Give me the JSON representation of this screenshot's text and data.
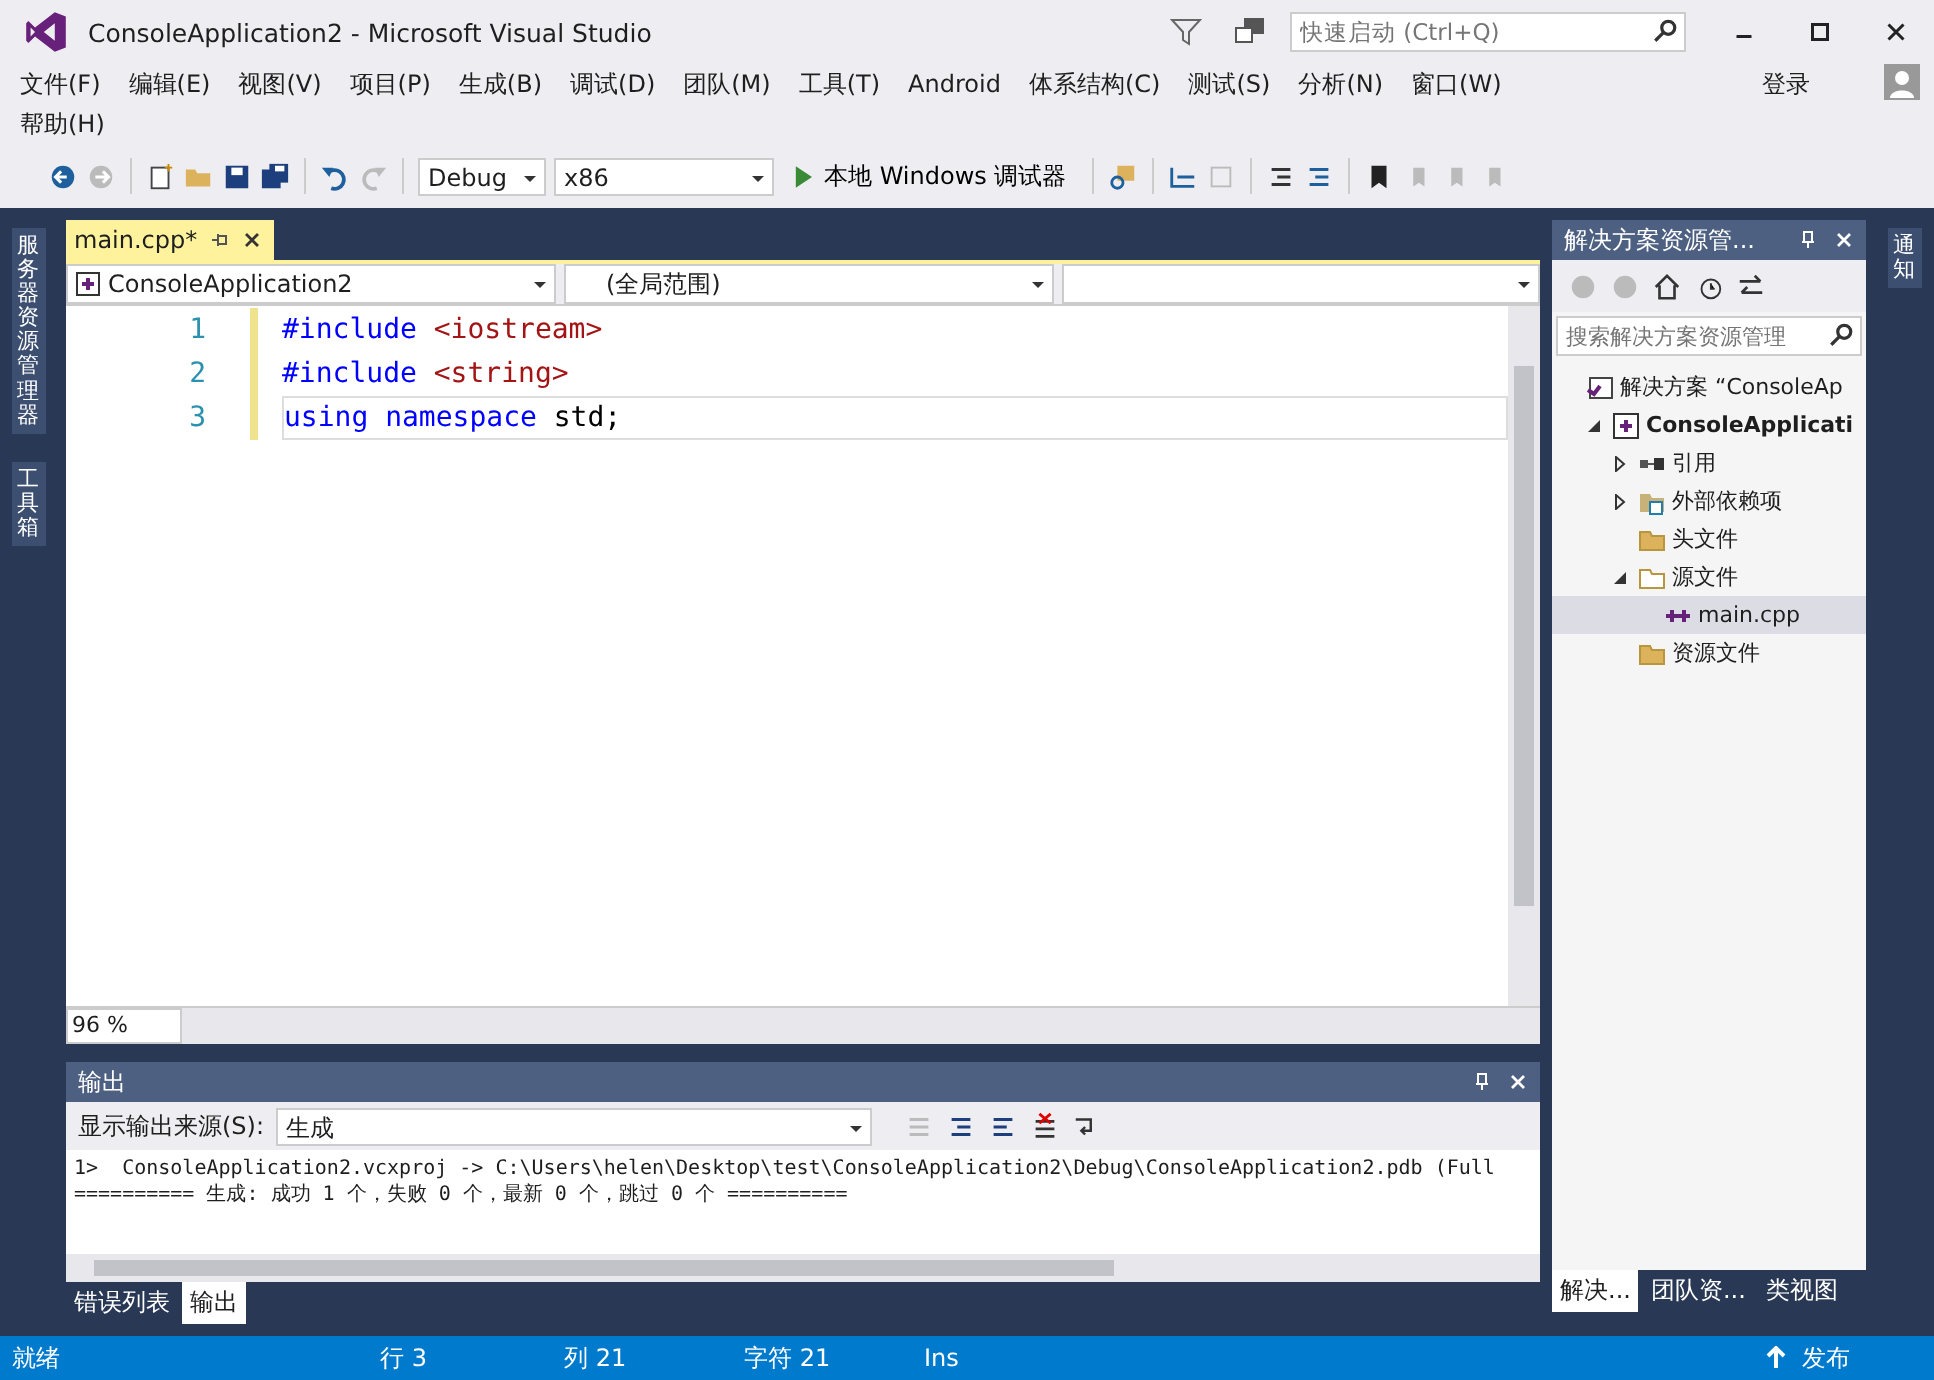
{
  "window": {
    "title": "ConsoleApplication2 - Microsoft Visual Studio",
    "quick_launch": {
      "placeholder": "快速启动 (Ctrl+Q)"
    }
  },
  "menu": [
    "文件(F)",
    "编辑(E)",
    "视图(V)",
    "项目(P)",
    "生成(B)",
    "调试(D)",
    "团队(M)",
    "工具(T)",
    "Android",
    "体系结构(C)",
    "测试(S)",
    "分析(N)",
    "窗口(W)",
    "帮助(H)"
  ],
  "sign_in": "登录",
  "toolbar": {
    "configuration": "Debug",
    "platform": "x86",
    "run": "本地 Windows 调试器"
  },
  "left_tabs": [
    "服务器资源管理器",
    "工具箱"
  ],
  "right_tabs": [
    "通知"
  ],
  "editor": {
    "tab": {
      "title": "main.cpp*"
    },
    "nav": {
      "project": "ConsoleApplication2",
      "scope": "(全局范围)"
    },
    "zoom": "96 %",
    "lines": [
      {
        "number": "1",
        "tokens": [
          {
            "text": "#include",
            "kind": "keyword"
          },
          {
            "text": " <iostream>",
            "kind": "string"
          }
        ]
      },
      {
        "number": "2",
        "tokens": [
          {
            "text": "#include",
            "kind": "keyword"
          },
          {
            "text": " <string>",
            "kind": "string"
          }
        ]
      },
      {
        "number": "3",
        "tokens": [
          {
            "text": "using namespace",
            "kind": "keyword"
          },
          {
            "text": " std;",
            "kind": "plain"
          }
        ]
      }
    ]
  },
  "solution_explorer": {
    "title": "解决方案资源管...",
    "search": {
      "placeholder": "搜索解决方案资源管理"
    },
    "tree": [
      {
        "label": "解决方案 “ConsoleAp",
        "kind": "solution",
        "selected": false,
        "children": [
          {
            "label": "ConsoleApplicati",
            "kind": "project",
            "expanded": true,
            "selected": false,
            "children": [
              {
                "label": "引用",
                "kind": "references",
                "expanded": false,
                "selected": false
              },
              {
                "label": "外部依赖项",
                "kind": "dependencies",
                "expanded": false,
                "selected": false
              },
              {
                "label": "头文件",
                "kind": "folder",
                "selected": false
              },
              {
                "label": "源文件",
                "kind": "folder",
                "expanded": true,
                "selected": false,
                "children": [
                  {
                    "label": "main.cpp",
                    "kind": "cpp",
                    "selected": true
                  }
                ]
              },
              {
                "label": "资源文件",
                "kind": "folder",
                "selected": false
              }
            ]
          }
        ]
      }
    ],
    "tabs": [
      {
        "label": "解决...",
        "selected": true
      },
      {
        "label": "团队资...",
        "selected": false
      },
      {
        "label": "类视图",
        "selected": false
      }
    ]
  },
  "output": {
    "title": "输出",
    "source_label": "显示输出来源(S):",
    "source": "生成",
    "lines": [
      "1>  ConsoleApplication2.vcxproj -> C:\\Users\\helen\\Desktop\\test\\ConsoleApplication2\\Debug\\ConsoleApplication2.pdb (Full",
      "========== 生成: 成功 1 个，失败 0 个，最新 0 个，跳过 0 个 =========="
    ]
  },
  "bottom_tabs": [
    {
      "label": "错误列表",
      "selected": false
    },
    {
      "label": "输出",
      "selected": true
    }
  ],
  "status_bar": {
    "state": "就绪",
    "line": "行 3",
    "column": "列 21",
    "char": "字符 21",
    "mode": "Ins",
    "publish": "发布"
  }
}
